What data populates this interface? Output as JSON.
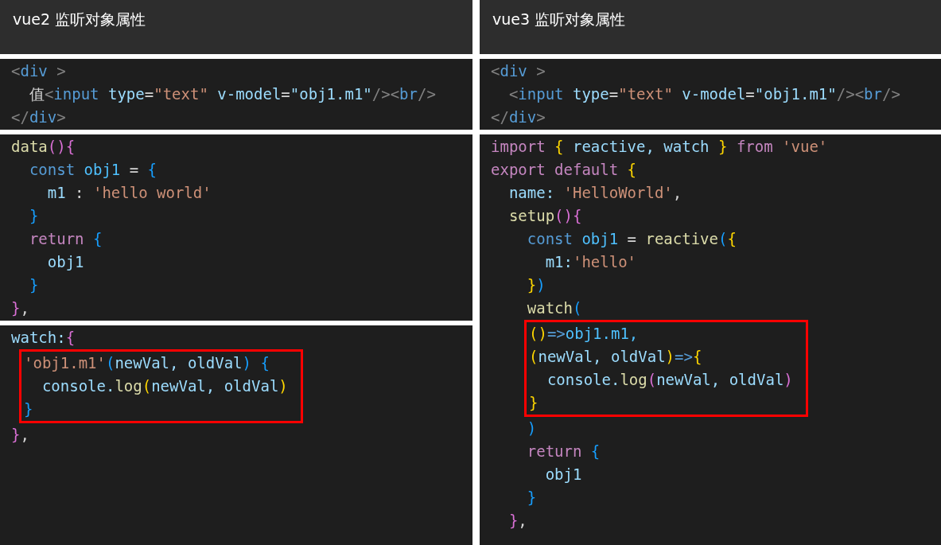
{
  "columns": [
    {
      "title": "vue2 监听对象属性",
      "panels": [
        {
          "items": [
            {
              "kind": "line",
              "tokens": [
                {
                  "text": "<",
                  "color": "#808080"
                },
                {
                  "text": "div",
                  "color": "#569cd6"
                },
                {
                  "text": " >",
                  "color": "#808080"
                }
              ]
            },
            {
              "kind": "line",
              "tokens": [
                {
                  "text": "  值",
                  "color": "#d4d4d4"
                },
                {
                  "text": "<",
                  "color": "#808080"
                },
                {
                  "text": "input",
                  "color": "#569cd6"
                },
                {
                  "text": " type",
                  "color": "#9cdcfe"
                },
                {
                  "text": "=",
                  "color": "#d4d4d4"
                },
                {
                  "text": "\"text\"",
                  "color": "#ce9178"
                },
                {
                  "text": " v-model",
                  "color": "#9cdcfe"
                },
                {
                  "text": "=",
                  "color": "#d4d4d4"
                },
                {
                  "text": "\"obj1.m1\"",
                  "color": "#9cdcfe"
                },
                {
                  "text": "/><",
                  "color": "#808080"
                },
                {
                  "text": "br",
                  "color": "#569cd6"
                },
                {
                  "text": "/>",
                  "color": "#808080"
                }
              ]
            },
            {
              "kind": "line",
              "tokens": [
                {
                  "text": "</",
                  "color": "#808080"
                },
                {
                  "text": "div",
                  "color": "#569cd6"
                },
                {
                  "text": ">",
                  "color": "#808080"
                }
              ]
            }
          ]
        },
        {
          "items": [
            {
              "kind": "line",
              "tokens": [
                {
                  "text": "data",
                  "color": "#dcdcaa"
                },
                {
                  "text": "(){",
                  "color": "#da70d6"
                }
              ]
            },
            {
              "kind": "line",
              "tokens": [
                {
                  "text": "  const",
                  "color": "#569cd6"
                },
                {
                  "text": " obj1",
                  "color": "#4fc1ff"
                },
                {
                  "text": " = ",
                  "color": "#d4d4d4"
                },
                {
                  "text": "{",
                  "color": "#179fff"
                }
              ]
            },
            {
              "kind": "line",
              "tokens": [
                {
                  "text": "    m1",
                  "color": "#9cdcfe"
                },
                {
                  "text": " : ",
                  "color": "#d4d4d4"
                },
                {
                  "text": "'hello world'",
                  "color": "#ce9178"
                }
              ]
            },
            {
              "kind": "line",
              "tokens": [
                {
                  "text": "  }",
                  "color": "#179fff"
                }
              ]
            },
            {
              "kind": "line",
              "tokens": [
                {
                  "text": "  return",
                  "color": "#c586c0"
                },
                {
                  "text": " {",
                  "color": "#179fff"
                }
              ]
            },
            {
              "kind": "line",
              "tokens": [
                {
                  "text": "    obj1",
                  "color": "#9cdcfe"
                }
              ]
            },
            {
              "kind": "line",
              "tokens": [
                {
                  "text": "  }",
                  "color": "#179fff"
                }
              ]
            },
            {
              "kind": "line",
              "tokens": [
                {
                  "text": "}",
                  "color": "#da70d6"
                },
                {
                  "text": ",",
                  "color": "#d4d4d4"
                }
              ]
            }
          ]
        },
        {
          "items": [
            {
              "kind": "line",
              "tokens": [
                {
                  "text": "watch:",
                  "color": "#9cdcfe"
                },
                {
                  "text": "{",
                  "color": "#da70d6"
                }
              ]
            },
            {
              "kind": "box",
              "lines": [
                {
                  "tokens": [
                    {
                      "text": "  'obj1.m1'",
                      "color": "#ce9178"
                    },
                    {
                      "text": "(",
                      "color": "#179fff"
                    },
                    {
                      "text": "newVal, oldVal",
                      "color": "#9cdcfe"
                    },
                    {
                      "text": ") {",
                      "color": "#179fff"
                    }
                  ]
                },
                {
                  "tokens": [
                    {
                      "text": "    console.",
                      "color": "#9cdcfe"
                    },
                    {
                      "text": "log",
                      "color": "#dcdcaa"
                    },
                    {
                      "text": "(",
                      "color": "#ffd700"
                    },
                    {
                      "text": "newVal, oldVal",
                      "color": "#9cdcfe"
                    },
                    {
                      "text": ")",
                      "color": "#ffd700"
                    }
                  ]
                },
                {
                  "tokens": [
                    {
                      "text": "  }",
                      "color": "#179fff"
                    }
                  ]
                }
              ]
            },
            {
              "kind": "line",
              "tokens": [
                {
                  "text": "}",
                  "color": "#da70d6"
                },
                {
                  "text": ",",
                  "color": "#d4d4d4"
                }
              ]
            }
          ]
        }
      ]
    },
    {
      "title": "vue3 监听对象属性",
      "panels": [
        {
          "items": [
            {
              "kind": "line",
              "tokens": [
                {
                  "text": "<",
                  "color": "#808080"
                },
                {
                  "text": "div",
                  "color": "#569cd6"
                },
                {
                  "text": " >",
                  "color": "#808080"
                }
              ]
            },
            {
              "kind": "line",
              "tokens": [
                {
                  "text": "  <",
                  "color": "#808080"
                },
                {
                  "text": "input",
                  "color": "#569cd6"
                },
                {
                  "text": " type",
                  "color": "#9cdcfe"
                },
                {
                  "text": "=",
                  "color": "#d4d4d4"
                },
                {
                  "text": "\"text\"",
                  "color": "#ce9178"
                },
                {
                  "text": " v-model",
                  "color": "#9cdcfe"
                },
                {
                  "text": "=",
                  "color": "#d4d4d4"
                },
                {
                  "text": "\"obj1.m1\"",
                  "color": "#9cdcfe"
                },
                {
                  "text": "/><",
                  "color": "#808080"
                },
                {
                  "text": "br",
                  "color": "#569cd6"
                },
                {
                  "text": "/>",
                  "color": "#808080"
                }
              ]
            },
            {
              "kind": "line",
              "tokens": [
                {
                  "text": "</",
                  "color": "#808080"
                },
                {
                  "text": "div",
                  "color": "#569cd6"
                },
                {
                  "text": ">",
                  "color": "#808080"
                }
              ]
            }
          ]
        },
        {
          "items": [
            {
              "kind": "line",
              "tokens": [
                {
                  "text": "import",
                  "color": "#c586c0"
                },
                {
                  "text": " { ",
                  "color": "#ffd700"
                },
                {
                  "text": "reactive, watch",
                  "color": "#9cdcfe"
                },
                {
                  "text": " } ",
                  "color": "#ffd700"
                },
                {
                  "text": "from",
                  "color": "#c586c0"
                },
                {
                  "text": " 'vue'",
                  "color": "#ce9178"
                }
              ]
            },
            {
              "kind": "line",
              "tokens": [
                {
                  "text": "export default",
                  "color": "#c586c0"
                },
                {
                  "text": " {",
                  "color": "#ffd700"
                }
              ]
            },
            {
              "kind": "line",
              "tokens": [
                {
                  "text": "  name: ",
                  "color": "#9cdcfe"
                },
                {
                  "text": "'HelloWorld'",
                  "color": "#ce9178"
                },
                {
                  "text": ",",
                  "color": "#d4d4d4"
                }
              ]
            },
            {
              "kind": "line",
              "tokens": [
                {
                  "text": "  setup",
                  "color": "#dcdcaa"
                },
                {
                  "text": "(){",
                  "color": "#da70d6"
                }
              ]
            },
            {
              "kind": "line",
              "tokens": [
                {
                  "text": "    const",
                  "color": "#569cd6"
                },
                {
                  "text": " obj1",
                  "color": "#4fc1ff"
                },
                {
                  "text": " = ",
                  "color": "#d4d4d4"
                },
                {
                  "text": "reactive",
                  "color": "#dcdcaa"
                },
                {
                  "text": "(",
                  "color": "#179fff"
                },
                {
                  "text": "{",
                  "color": "#ffd700"
                }
              ]
            },
            {
              "kind": "line",
              "tokens": [
                {
                  "text": "      m1:",
                  "color": "#9cdcfe"
                },
                {
                  "text": "'hello'",
                  "color": "#ce9178"
                }
              ]
            },
            {
              "kind": "line",
              "tokens": [
                {
                  "text": "    }",
                  "color": "#ffd700"
                },
                {
                  "text": ")",
                  "color": "#179fff"
                }
              ]
            },
            {
              "kind": "line",
              "tokens": [
                {
                  "text": "    watch",
                  "color": "#dcdcaa"
                },
                {
                  "text": "(",
                  "color": "#179fff"
                }
              ]
            },
            {
              "kind": "box",
              "lines": [
                {
                  "tokens": [
                    {
                      "text": "      ()",
                      "color": "#ffd700"
                    },
                    {
                      "text": "=>",
                      "color": "#569cd6"
                    },
                    {
                      "text": "obj1.m1,",
                      "color": "#4fc1ff"
                    }
                  ]
                },
                {
                  "tokens": [
                    {
                      "text": "      (",
                      "color": "#ffd700"
                    },
                    {
                      "text": "newVal, oldVal",
                      "color": "#9cdcfe"
                    },
                    {
                      "text": ")",
                      "color": "#ffd700"
                    },
                    {
                      "text": "=>",
                      "color": "#569cd6"
                    },
                    {
                      "text": "{",
                      "color": "#ffd700"
                    }
                  ]
                },
                {
                  "tokens": [
                    {
                      "text": "        console.",
                      "color": "#9cdcfe"
                    },
                    {
                      "text": "log",
                      "color": "#dcdcaa"
                    },
                    {
                      "text": "(",
                      "color": "#da70d6"
                    },
                    {
                      "text": "newVal, oldVal",
                      "color": "#9cdcfe"
                    },
                    {
                      "text": ")",
                      "color": "#da70d6"
                    }
                  ]
                },
                {
                  "tokens": [
                    {
                      "text": "      }",
                      "color": "#ffd700"
                    }
                  ]
                }
              ]
            },
            {
              "kind": "line",
              "tokens": [
                {
                  "text": "    )",
                  "color": "#179fff"
                }
              ]
            },
            {
              "kind": "line",
              "tokens": [
                {
                  "text": "    return",
                  "color": "#c586c0"
                },
                {
                  "text": " {",
                  "color": "#179fff"
                }
              ]
            },
            {
              "kind": "line",
              "tokens": [
                {
                  "text": "      obj1",
                  "color": "#9cdcfe"
                }
              ]
            },
            {
              "kind": "line",
              "tokens": [
                {
                  "text": "    }",
                  "color": "#179fff"
                }
              ]
            },
            {
              "kind": "line",
              "tokens": [
                {
                  "text": "  }",
                  "color": "#da70d6"
                },
                {
                  "text": ",",
                  "color": "#d4d4d4"
                }
              ]
            }
          ]
        }
      ]
    }
  ]
}
